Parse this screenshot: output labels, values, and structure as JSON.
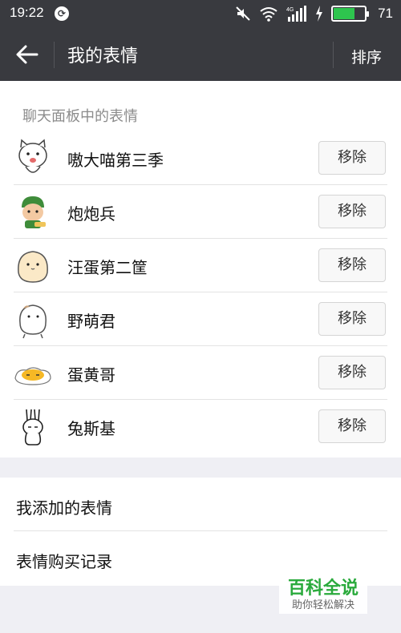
{
  "status_bar": {
    "time": "19:22",
    "battery": "71",
    "network": "4G"
  },
  "navbar": {
    "title": "我的表情",
    "sort_label": "排序"
  },
  "section": {
    "title": "聊天面板中的表情"
  },
  "stickers": [
    {
      "name": "嗷大喵第三季",
      "remove_label": "移除",
      "icon": "cat-sticker-icon"
    },
    {
      "name": "炮炮兵",
      "remove_label": "移除",
      "icon": "soldier-sticker-icon"
    },
    {
      "name": "汪蛋第二筐",
      "remove_label": "移除",
      "icon": "egg-sticker-icon"
    },
    {
      "name": "野萌君",
      "remove_label": "移除",
      "icon": "bun-sticker-icon"
    },
    {
      "name": "蛋黄哥",
      "remove_label": "移除",
      "icon": "egg-yolk-sticker-icon"
    },
    {
      "name": "兔斯基",
      "remove_label": "移除",
      "icon": "rabbit-sticker-icon"
    }
  ],
  "links": [
    {
      "label": "我添加的表情"
    },
    {
      "label": "表情购买记录"
    }
  ],
  "watermark": {
    "title": "百科全说",
    "subtitle": "助你轻松解决"
  },
  "colors": {
    "topbar": "#393a3f",
    "battery": "#2ec54e",
    "watermark_green": "#2aaa3c"
  }
}
